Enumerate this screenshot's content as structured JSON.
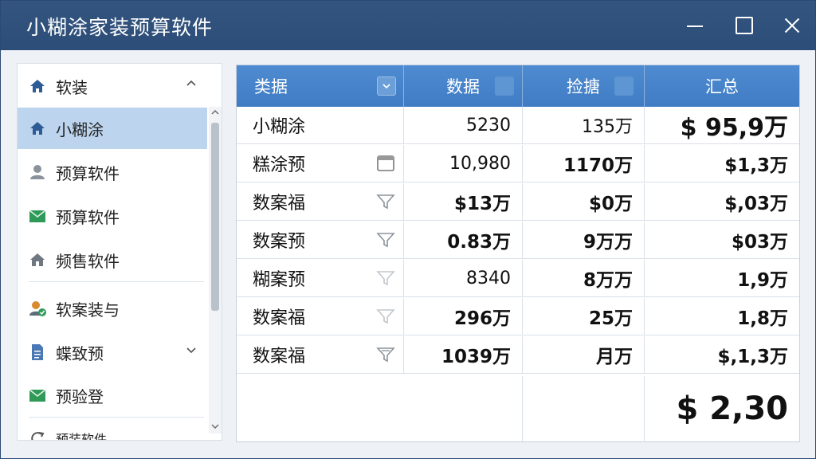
{
  "window": {
    "title": "小糊涂家装预算软件"
  },
  "sidebar": {
    "items": [
      {
        "label": "软装",
        "icon": "home-icon"
      },
      {
        "label": "小糊涂",
        "icon": "home-icon"
      },
      {
        "label": "预算软件",
        "icon": "user-icon"
      },
      {
        "label": "预算软件",
        "icon": "mail-icon"
      },
      {
        "label": "频售软件",
        "icon": "house-icon"
      },
      {
        "label": "软案装与",
        "icon": "user-check-icon"
      },
      {
        "label": "蝶致预",
        "icon": "document-icon"
      },
      {
        "label": "预验登",
        "icon": "mail-icon"
      },
      {
        "label": "预装软件",
        "icon": "refresh-icon"
      }
    ]
  },
  "table": {
    "headers": [
      "类据",
      "数据",
      "捡搪",
      "汇总"
    ],
    "rows": [
      [
        "小糊涂",
        "5230",
        "135万",
        "$ 95,9万"
      ],
      [
        "糕涂预",
        "10,980",
        "1170万",
        "$1,3万"
      ],
      [
        "数案福",
        "$13万",
        "$0万",
        "$,03万"
      ],
      [
        "数案预",
        "0.83万",
        "9万万",
        "$03万"
      ],
      [
        "糊案预",
        "8340",
        "8万万",
        "1,9万"
      ],
      [
        "数案福",
        "296万",
        "25万",
        "1,8万"
      ],
      [
        "数案福",
        "1039万",
        "月万",
        "$,1,3万"
      ]
    ],
    "total": "$ 2,30"
  }
}
